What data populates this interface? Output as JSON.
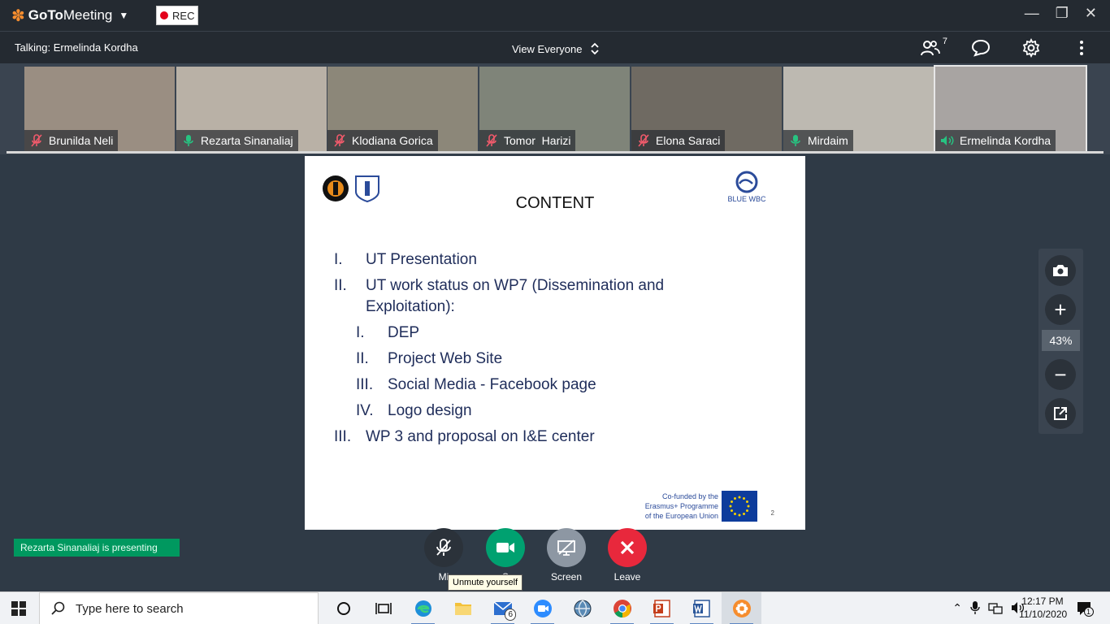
{
  "app": {
    "name_prefix": "GoTo",
    "name_suffix": "Meeting",
    "rec_label": "REC"
  },
  "infobar": {
    "talking": "Talking: Ermelinda Kordha",
    "view": "View Everyone",
    "attendee_count": "7"
  },
  "participants": [
    {
      "name": "Brunilda Neli",
      "mic": "muted",
      "bg": "#9a8e82"
    },
    {
      "name": "Rezarta Sinanaliaj",
      "mic": "on",
      "bg": "#b9b1a6"
    },
    {
      "name": "Klodiana Gorica",
      "mic": "muted",
      "bg": "#8c8779"
    },
    {
      "name": "Tomor  Harizi",
      "mic": "muted",
      "bg": "#7f8479"
    },
    {
      "name": "Elona Saraci",
      "mic": "muted",
      "bg": "#6f6a62"
    },
    {
      "name": "Mirdaim",
      "mic": "on",
      "bg": "#bdb9b1"
    },
    {
      "name": "Ermelinda Kordha",
      "mic": "speaking",
      "bg": "#a8a4a2"
    }
  ],
  "slide": {
    "title": "CONTENT",
    "partner_logo": "BLUE WBC",
    "items": [
      {
        "num": "I.",
        "text": "UT Presentation",
        "level": 0
      },
      {
        "num": "II.",
        "text": "UT work status on WP7 (Dissemination and",
        "level": 0,
        "cont": "Exploitation):"
      },
      {
        "num": "I.",
        "text": "DEP",
        "level": 1
      },
      {
        "num": "II.",
        "text": "Project Web Site",
        "level": 1
      },
      {
        "num": "III.",
        "text": "Social Media - Facebook page",
        "level": 1
      },
      {
        "num": "IV.",
        "text": "Logo design",
        "level": 1
      },
      {
        "num": "III.",
        "text": "WP 3  and proposal on I&E center",
        "level": 0
      }
    ],
    "cofund_lines": [
      "Co-funded by the",
      "Erasmus+ Programme",
      "of the European Union"
    ],
    "page_number": "2"
  },
  "zoom": {
    "level": "43%"
  },
  "presenting_notice": "Rezarta Sinanaliaj is presenting",
  "controls": {
    "mic_label": "Mi",
    "camera_label": "S",
    "screen_label": "Screen",
    "leave_label": "Leave",
    "tooltip": "Unmute yourself"
  },
  "taskbar": {
    "search_placeholder": "Type here to search",
    "time": "12:17 PM",
    "date": "11/10/2020",
    "mail_badge": "6",
    "notif_count": "1"
  },
  "colors": {
    "rec": "#e3001b",
    "camera": "#00a170",
    "leave": "#e8283c",
    "presenting": "#00985f",
    "accent": "#f68d2e"
  }
}
